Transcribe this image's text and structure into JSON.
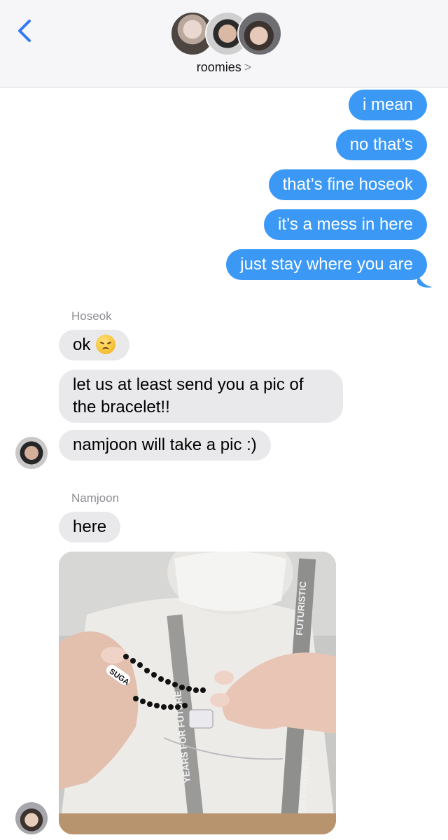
{
  "header": {
    "back_icon": "chevron-left-icon",
    "group_name": "roomies",
    "chevron": ">",
    "accent": "#3478f6"
  },
  "messages_outgoing": [
    "i mean",
    "no that’s",
    "that’s fine hoseok",
    "it’s a mess in here",
    "just stay where you are"
  ],
  "group_hoseok": {
    "sender": "Hoseok",
    "messages": [
      "ok",
      "let us at least send you a pic of the bracelet!!",
      "namjoon will take a pic :)"
    ],
    "emoji": "disappointed-face-icon"
  },
  "group_namjoon": {
    "sender": "Namjoon",
    "messages": [
      "here"
    ],
    "photo_text": [
      "SUGA",
      "YEARS FOR FUTURE",
      "FUTURISTIC",
      "RS FOR FUTURIST"
    ]
  },
  "colors": {
    "outgoing_bubble": "#3b99f5",
    "incoming_bubble": "#e9e9eb",
    "header_bg": "#f6f6f8"
  }
}
